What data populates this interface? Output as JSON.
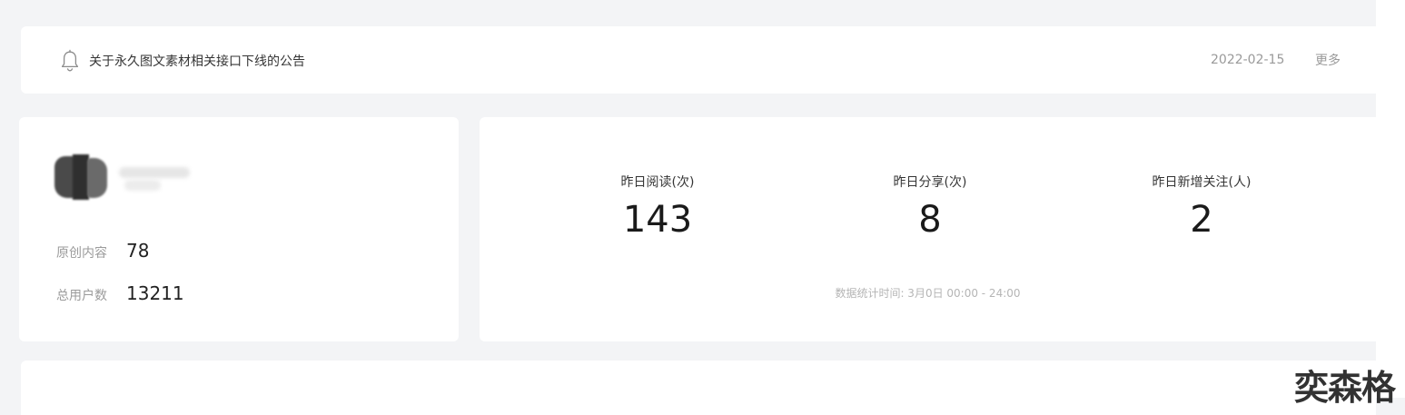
{
  "notice": {
    "text": "关于永久图文素材相关接口下线的公告",
    "date": "2022-02-15",
    "more_label": "更多",
    "icon": "bell-icon"
  },
  "account": {
    "avatar_icon": "avatar-blurred",
    "stats": [
      {
        "label": "原创内容",
        "value": "78"
      },
      {
        "label": "总用户数",
        "value": "13211"
      }
    ]
  },
  "yesterday": {
    "metrics": [
      {
        "label": "昨日阅读(次)",
        "value": "143"
      },
      {
        "label": "昨日分享(次)",
        "value": "8"
      },
      {
        "label": "昨日新增关注(人)",
        "value": "2"
      }
    ],
    "footnote": "数据统计时间: 3月0日 00:00 - 24:00"
  },
  "watermark": "奕森格",
  "colors": {
    "page_bg": "#f3f4f6",
    "card_bg": "#ffffff",
    "muted_text": "#9b9b9b"
  }
}
